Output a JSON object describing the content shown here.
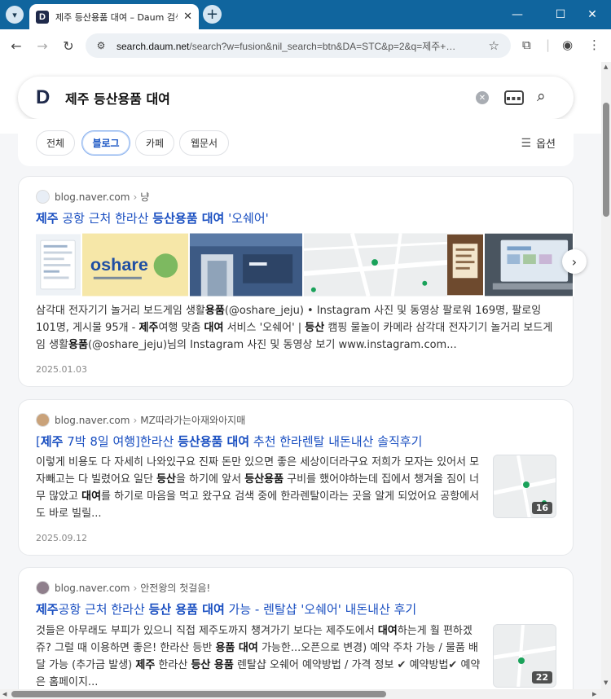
{
  "browser": {
    "tab_title": "제주 등산용품 대여 – Daum 검색",
    "favicon_letter": "D",
    "url_host": "search.daum.net",
    "url_path": "/search?w=fusion&nil_search=btn&DA=STC&p=2&q=제주+…",
    "icons": {
      "tab_menu": "chevron-down-icon",
      "new_tab": "plus-icon",
      "minimize": "minimize-icon",
      "maximize": "maximize-icon",
      "close": "close-icon",
      "back": "arrow-left-icon",
      "forward": "arrow-right-icon",
      "reload": "reload-icon",
      "site_info": "tune-icon",
      "bookmark": "star-icon",
      "extensions": "puzzle-icon",
      "profile": "profile-icon",
      "menu": "kebab-menu-icon"
    }
  },
  "search": {
    "logo": "D",
    "query": "제주 등산용품 대여"
  },
  "filters": {
    "tabs": [
      "전체",
      "블로그",
      "카페",
      "웹문서"
    ],
    "active": "블로그",
    "options_label": "옵션"
  },
  "results": [
    {
      "source": "blog.naver.com",
      "author": "냥",
      "title_parts": [
        {
          "t": "제주",
          "b": true
        },
        {
          "t": " 공항 근처 한라산 ",
          "b": false
        },
        {
          "t": "등산용품 대여",
          "b": true
        },
        {
          "t": " '오쉐어'",
          "b": false
        }
      ],
      "thumb_text": "oshare",
      "desc_parts": [
        {
          "t": "삼각대 전자기기 놀거리 보드게임 생활",
          "b": false
        },
        {
          "t": "용품",
          "b": true
        },
        {
          "t": "(@oshare_jeju) • Instagram 사진 및 동영상 팔로워 169명, 팔로잉 101명, 게시물 95개 - ",
          "b": false
        },
        {
          "t": "제주",
          "b": true
        },
        {
          "t": "여행 맞춤 ",
          "b": false
        },
        {
          "t": "대여",
          "b": true
        },
        {
          "t": " 서비스 '오쉐어' | ",
          "b": false
        },
        {
          "t": "등산",
          "b": true
        },
        {
          "t": " 캠핑 물놀이 카메라 삼각대 전자기기 놀거리 보드게임 생활",
          "b": false
        },
        {
          "t": "용품",
          "b": true
        },
        {
          "t": "(@oshare_jeju)님의 Instagram 사진 및 동영상 보기 www.instagram.com...",
          "b": false
        }
      ],
      "date": "2025.01.03"
    },
    {
      "source": "blog.naver.com",
      "author": "MZ따라가는아재와아지매",
      "title_parts": [
        {
          "t": "[",
          "b": false
        },
        {
          "t": "제주",
          "b": true
        },
        {
          "t": " 7박 8일 여행]한라산 ",
          "b": false
        },
        {
          "t": "등산용품 대여",
          "b": true
        },
        {
          "t": " 추천 한라렌탈 내돈내산 솔직후기",
          "b": false
        }
      ],
      "desc_parts": [
        {
          "t": "이렇게 비용도 다 자세히 나와있구요 진짜 돈만 있으면 좋은 세상이더라구요 저희가 모자는 있어서 모자빼고는 다 빌렸어요 일단 ",
          "b": false
        },
        {
          "t": "등산",
          "b": true
        },
        {
          "t": "을 하기에 앞서 ",
          "b": false
        },
        {
          "t": "등산용품",
          "b": true
        },
        {
          "t": " 구비를 했어야하는데 집에서 챙겨올 짐이 너무 많았고 ",
          "b": false
        },
        {
          "t": "대여",
          "b": true
        },
        {
          "t": "를 하기로 마음을 먹고 왔구요 검색 중에 한라렌탈이라는 곳을 알게 되었어요 공항에서도 바로 빌릴...",
          "b": false
        }
      ],
      "image_count": "16",
      "date": "2025.09.12"
    },
    {
      "source": "blog.naver.com",
      "author": "안전왕의 첫걸음!",
      "title_parts": [
        {
          "t": "제주",
          "b": true
        },
        {
          "t": "공항 근처 한라산 ",
          "b": false
        },
        {
          "t": "등산 용품 대여",
          "b": true
        },
        {
          "t": " 가능 - 렌탈샵 '오쉐어' 내돈내산 후기",
          "b": false
        }
      ],
      "desc_parts": [
        {
          "t": "것들은 아무래도 부피가 있으니 직접 제주도까지 챙겨가기 보다는 제주도에서 ",
          "b": false
        },
        {
          "t": "대여",
          "b": true
        },
        {
          "t": "하는게 훨 편하겠쥬? 그럴 때 이용하면 좋은! 한라산 등반 ",
          "b": false
        },
        {
          "t": "용품 대여",
          "b": true
        },
        {
          "t": " 가능한...오픈으로 변경) 예약 주차 가능 / 물품 배달 가능 (추가금 발생) ",
          "b": false
        },
        {
          "t": "제주",
          "b": true
        },
        {
          "t": " 한라산 ",
          "b": false
        },
        {
          "t": "등산 용품",
          "b": true
        },
        {
          "t": " 렌탈샵 오쉐어 예약방법 / 가격 정보 ✔ 예약방법✔ 예약은 홈페이지...",
          "b": false
        }
      ],
      "image_count": "22"
    }
  ]
}
